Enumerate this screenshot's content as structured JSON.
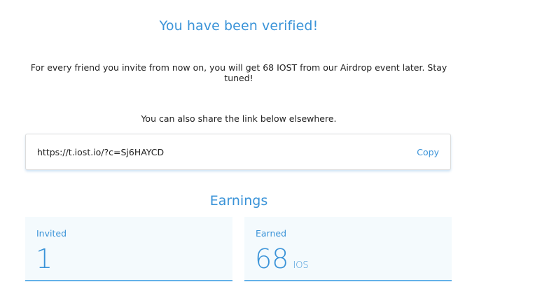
{
  "header": {
    "title": "You have been verified!"
  },
  "message": {
    "invite_text": "For every friend you invite from now on, you will get 68 IOST from our Airdrop event later. Stay tuned!",
    "share_note": "You can also share the link below elsewhere."
  },
  "share_link": {
    "url": "https://t.iost.io/?c=Sj6HAYCD",
    "copy_label": "Copy"
  },
  "earnings": {
    "title": "Earnings",
    "invited": {
      "label": "Invited",
      "value": "1"
    },
    "earned": {
      "label": "Earned",
      "value": "68",
      "unit": "IOS"
    }
  },
  "colors": {
    "accent": "#3a93d8",
    "card_bg": "#f4fafd",
    "card_border": "#64b1e8"
  }
}
